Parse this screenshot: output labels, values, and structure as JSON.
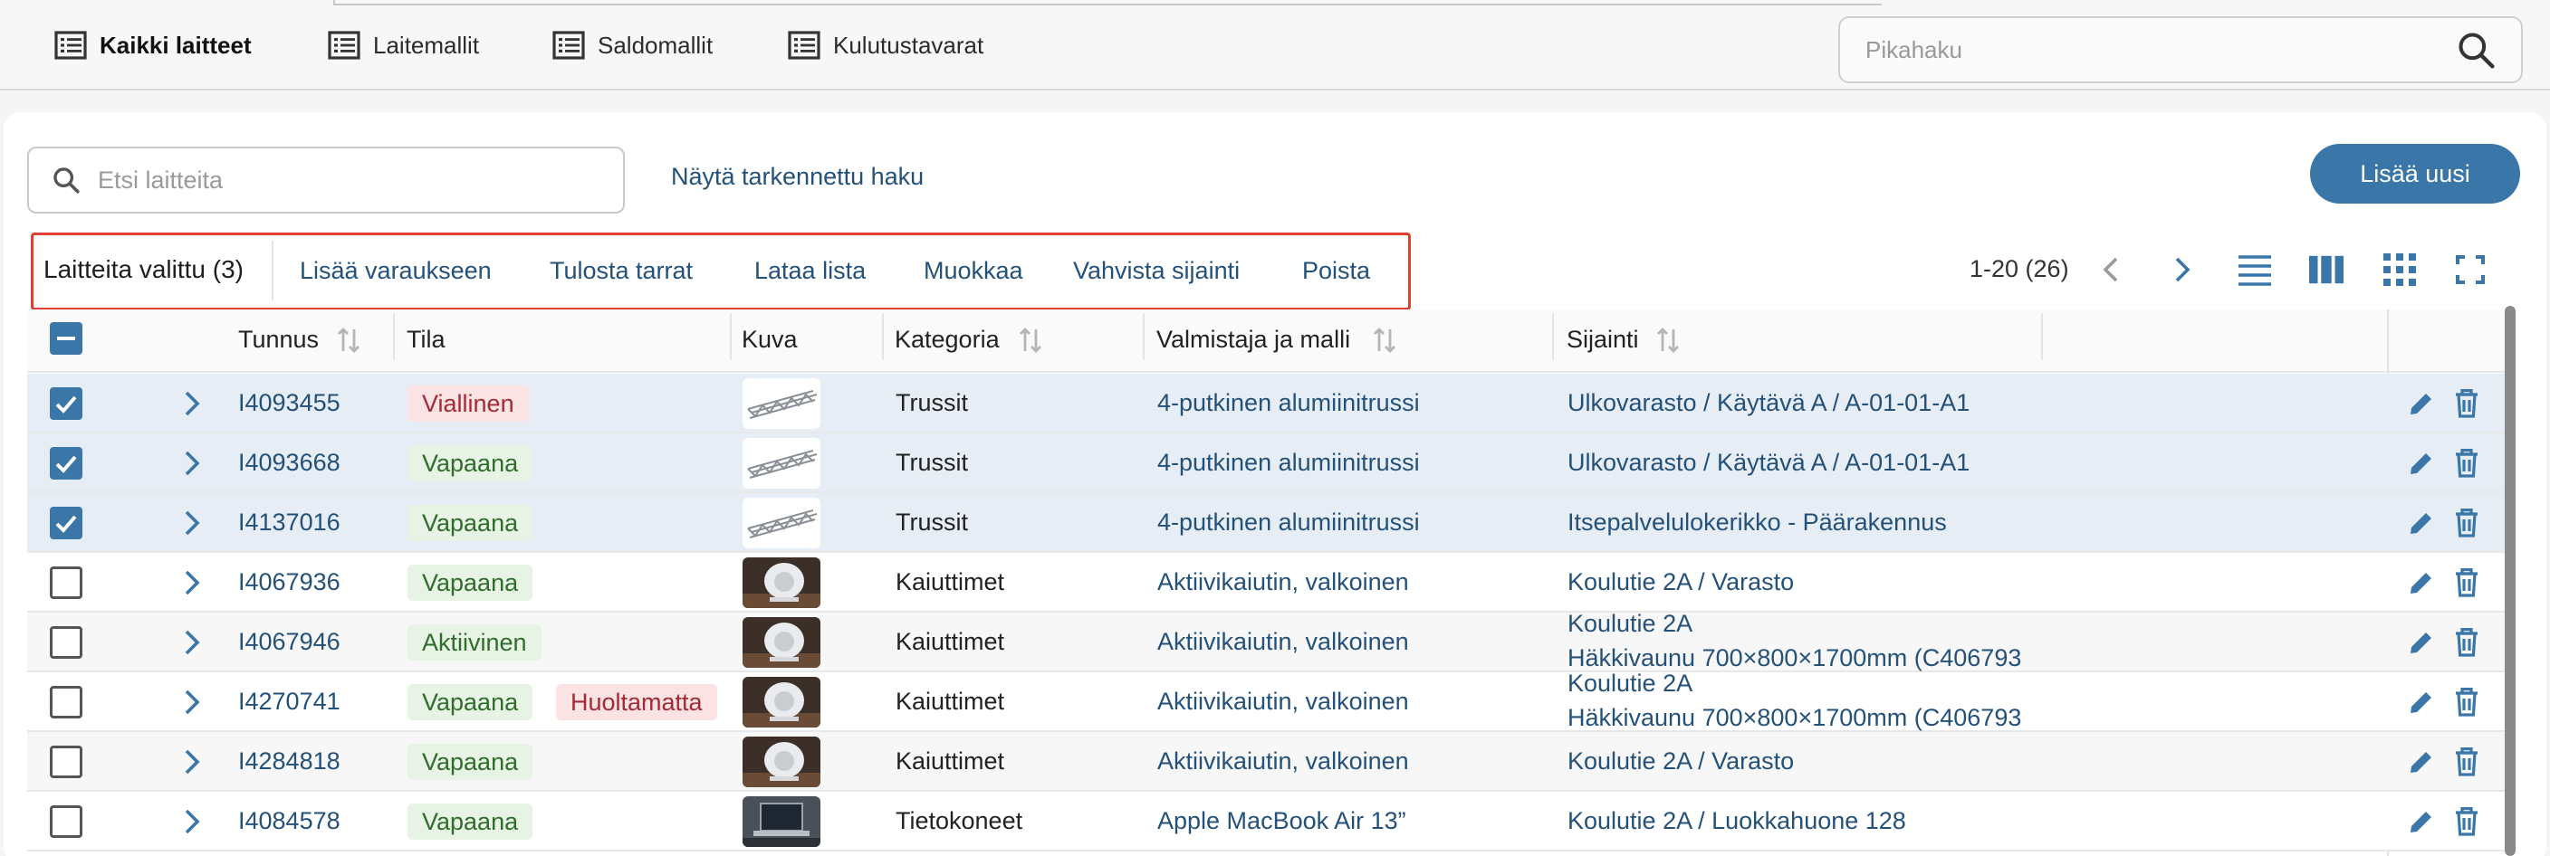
{
  "nav": {
    "items": [
      {
        "label": "Kaikki laitteet",
        "icon": "list-icon",
        "active": true
      },
      {
        "label": "Laitemallit",
        "icon": "list-icon",
        "active": false
      },
      {
        "label": "Saldomallit",
        "icon": "list-icon",
        "active": false
      },
      {
        "label": "Kulutustavarat",
        "icon": "list-icon",
        "active": false
      }
    ],
    "quick_search_placeholder": "Pikahaku"
  },
  "toolbar": {
    "search_placeholder": "Etsi laitteita",
    "advanced_search_label": "Näytä tarkennettu haku",
    "add_new_label": "Lisää uusi"
  },
  "bulk": {
    "selected_label": "Laitteita valittu (3)",
    "actions": [
      "Lisää varaukseen",
      "Tulosta tarrat",
      "Lataa lista",
      "Muokkaa",
      "Vahvista sijainti",
      "Poista"
    ]
  },
  "pager": {
    "range": "1-20 (26)"
  },
  "table": {
    "columns": [
      "Tunnus",
      "Tila",
      "Kuva",
      "Kategoria",
      "Valmistaja ja malli",
      "Sijainti"
    ],
    "rows": [
      {
        "selected": true,
        "id": "I4093455",
        "statuses": [
          {
            "text": "Viallinen",
            "tone": "red"
          }
        ],
        "image": "truss",
        "category": "Trussit",
        "model": "4-putkinen alumiinitrussi",
        "location": [
          "Ulkovarasto / Käytävä A / A-01-01-A1"
        ]
      },
      {
        "selected": true,
        "id": "I4093668",
        "statuses": [
          {
            "text": "Vapaana",
            "tone": "green"
          }
        ],
        "image": "truss",
        "category": "Trussit",
        "model": "4-putkinen alumiinitrussi",
        "location": [
          "Ulkovarasto / Käytävä A / A-01-01-A1"
        ]
      },
      {
        "selected": true,
        "id": "I4137016",
        "statuses": [
          {
            "text": "Vapaana",
            "tone": "green"
          }
        ],
        "image": "truss",
        "category": "Trussit",
        "model": "4-putkinen alumiinitrussi",
        "location": [
          "Itsepalvelulokerikko - Päärakennus"
        ]
      },
      {
        "selected": false,
        "id": "I4067936",
        "statuses": [
          {
            "text": "Vapaana",
            "tone": "green"
          }
        ],
        "image": "speaker",
        "category": "Kaiuttimet",
        "model": "Aktiivikaiutin, valkoinen",
        "location": [
          "Koulutie 2A / Varasto"
        ]
      },
      {
        "selected": false,
        "id": "I4067946",
        "statuses": [
          {
            "text": "Aktiivinen",
            "tone": "green"
          }
        ],
        "image": "speaker",
        "category": "Kaiuttimet",
        "model": "Aktiivikaiutin, valkoinen",
        "location": [
          "Koulutie 2A",
          "Häkkivaunu 700×800×1700mm (C406793"
        ]
      },
      {
        "selected": false,
        "id": "I4270741",
        "statuses": [
          {
            "text": "Vapaana",
            "tone": "green"
          },
          {
            "text": "Huoltamatta",
            "tone": "red"
          }
        ],
        "image": "speaker",
        "category": "Kaiuttimet",
        "model": "Aktiivikaiutin, valkoinen",
        "location": [
          "Koulutie 2A",
          "Häkkivaunu 700×800×1700mm (C406793"
        ]
      },
      {
        "selected": false,
        "id": "I4284818",
        "statuses": [
          {
            "text": "Vapaana",
            "tone": "green"
          }
        ],
        "image": "speaker",
        "category": "Kaiuttimet",
        "model": "Aktiivikaiutin, valkoinen",
        "location": [
          "Koulutie 2A / Varasto"
        ]
      },
      {
        "selected": false,
        "id": "I4084578",
        "statuses": [
          {
            "text": "Vapaana",
            "tone": "green"
          }
        ],
        "image": "laptop",
        "category": "Tietokoneet",
        "model": "Apple MacBook Air 13”",
        "location": [
          "Koulutie 2A / Luokkahuone 128"
        ]
      }
    ]
  },
  "colors": {
    "accent": "#3a76a8",
    "link": "#24517a",
    "highlight_border": "#e0402f",
    "selected_row": "#e6edf4"
  }
}
